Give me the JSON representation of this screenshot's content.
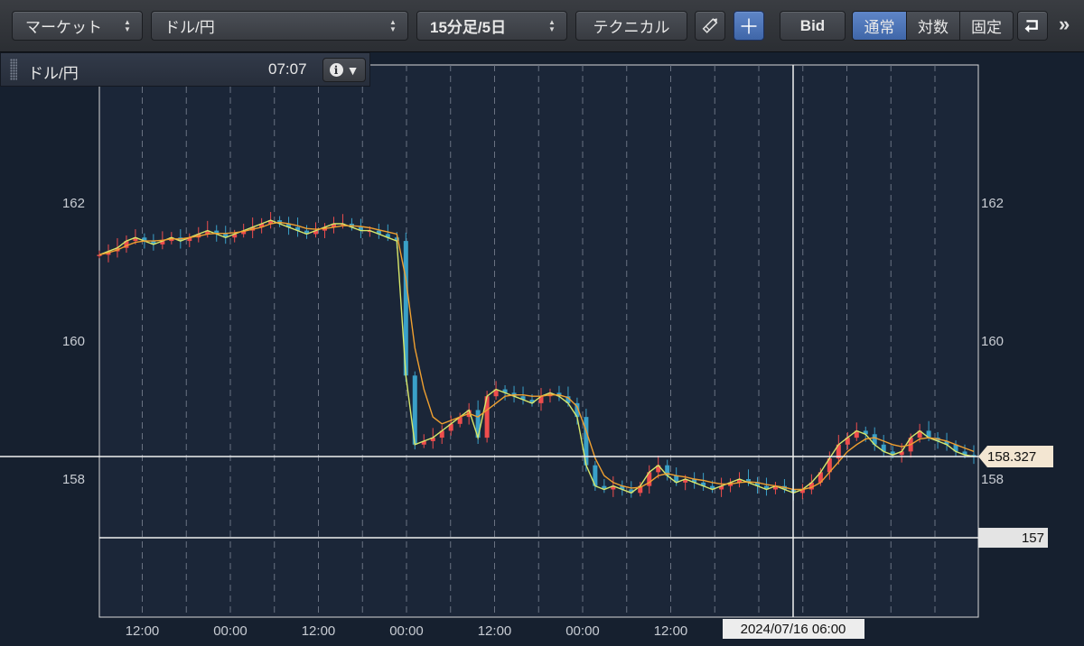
{
  "toolbar": {
    "market_label": "マーケット",
    "pair_label": "ドル/円",
    "timeframe_label": "15分足/5日",
    "technical_label": "テクニカル",
    "bid_label": "Bid",
    "scale_options": [
      "通常",
      "対数",
      "固定"
    ],
    "scale_selected": "通常",
    "icons": [
      "pencil-icon",
      "crosshair-icon",
      "return-icon",
      "more-icon"
    ]
  },
  "info": {
    "symbol": "ドル/円",
    "time": "07:07"
  },
  "chart_data": {
    "type": "line",
    "title": "",
    "ylim": [
      156,
      164
    ],
    "y_ticks": [
      "162",
      "160",
      "158"
    ],
    "x_tick_labels": [
      "12:00",
      "00:00",
      "12:00",
      "00:00",
      "12:00",
      "00:00",
      "12:00",
      "00:00"
    ],
    "crosshair_label": "2024/07/16 06:00",
    "current_price_label": "158.327",
    "current_price": 158.327,
    "horizontal_line_label": "157",
    "horizontal_line": 157.15,
    "grid": true,
    "series": [
      {
        "color": "#d8e86a",
        "values": [
          161.25,
          161.3,
          161.35,
          161.45,
          161.5,
          161.45,
          161.4,
          161.45,
          161.5,
          161.45,
          161.5,
          161.55,
          161.6,
          161.55,
          161.5,
          161.55,
          161.6,
          161.65,
          161.7,
          161.75,
          161.7,
          161.65,
          161.6,
          161.55,
          161.6,
          161.65,
          161.7,
          161.7,
          161.65,
          161.6,
          161.6,
          161.55,
          161.5,
          161.45,
          159.5,
          158.5,
          158.55,
          158.6,
          158.7,
          158.8,
          158.9,
          159.0,
          158.6,
          159.2,
          159.3,
          159.25,
          159.2,
          159.15,
          159.1,
          159.2,
          159.25,
          159.2,
          159.1,
          158.9,
          158.2,
          157.9,
          157.85,
          157.9,
          157.85,
          157.8,
          157.9,
          158.1,
          158.2,
          158.05,
          157.95,
          158.0,
          157.95,
          157.9,
          157.85,
          157.9,
          157.95,
          158.0,
          157.95,
          157.9,
          157.85,
          157.9,
          157.85,
          157.8,
          157.85,
          157.95,
          158.1,
          158.3,
          158.5,
          158.6,
          158.7,
          158.65,
          158.5,
          158.4,
          158.35,
          158.4,
          158.6,
          158.7,
          158.6,
          158.55,
          158.5,
          158.4,
          158.35,
          158.33
        ]
      },
      {
        "color": "#f0a030",
        "values": [
          161.25,
          161.28,
          161.32,
          161.38,
          161.43,
          161.45,
          161.45,
          161.46,
          161.48,
          161.48,
          161.5,
          161.52,
          161.55,
          161.56,
          161.56,
          161.57,
          161.59,
          161.62,
          161.65,
          161.7,
          161.72,
          161.7,
          161.67,
          161.63,
          161.62,
          161.63,
          161.65,
          161.67,
          161.67,
          161.66,
          161.64,
          161.61,
          161.58,
          161.55,
          160.9,
          159.9,
          159.3,
          158.9,
          158.8,
          158.85,
          158.9,
          158.95,
          158.9,
          159.0,
          159.1,
          159.2,
          159.22,
          159.22,
          159.2,
          159.2,
          159.22,
          159.22,
          159.18,
          159.05,
          158.7,
          158.3,
          158.05,
          157.95,
          157.9,
          157.87,
          157.88,
          157.95,
          158.05,
          158.08,
          158.05,
          158.03,
          158.0,
          157.98,
          157.95,
          157.93,
          157.93,
          157.95,
          157.96,
          157.95,
          157.92,
          157.9,
          157.88,
          157.85,
          157.85,
          157.88,
          157.95,
          158.1,
          158.25,
          158.4,
          158.5,
          158.58,
          158.6,
          158.55,
          158.5,
          158.47,
          158.5,
          158.58,
          158.6,
          158.58,
          158.55,
          158.5,
          158.45,
          158.4
        ]
      }
    ]
  }
}
